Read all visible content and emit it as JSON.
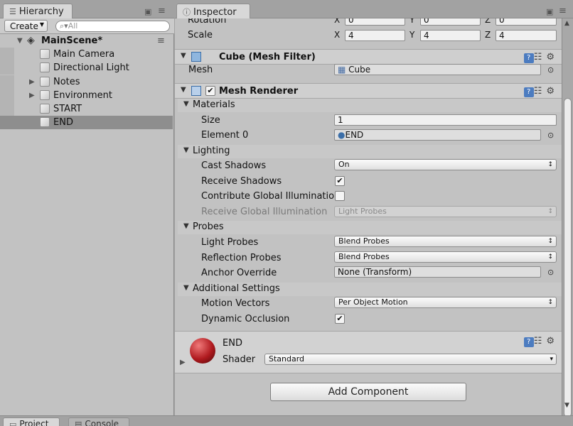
{
  "hierarchy": {
    "tab_label": "Hierarchy",
    "create_label": "Create",
    "search_placeholder": "All",
    "scene_name": "MainScene*",
    "items": [
      {
        "label": "Main Camera"
      },
      {
        "label": "Directional Light"
      },
      {
        "label": "Notes"
      },
      {
        "label": "Environment"
      },
      {
        "label": "START"
      },
      {
        "label": "END"
      }
    ]
  },
  "inspector": {
    "tab_label": "Inspector",
    "transform": {
      "rotation_label": "Rotation",
      "scale_label": "Scale",
      "rotation": {
        "x": "0",
        "y": "0",
        "z": "0"
      },
      "scale": {
        "x": "4",
        "y": "4",
        "z": "4"
      },
      "axis_x": "X",
      "axis_y": "Y",
      "axis_z": "Z"
    },
    "mesh_filter": {
      "title": "Cube (Mesh Filter)",
      "mesh_label": "Mesh",
      "mesh_value": "Cube"
    },
    "mesh_renderer": {
      "title": "Mesh Renderer",
      "enabled": true,
      "materials_label": "Materials",
      "size_label": "Size",
      "size_value": "1",
      "element0_label": "Element 0",
      "element0_value": "END",
      "lighting_label": "Lighting",
      "cast_shadows_label": "Cast Shadows",
      "cast_shadows_value": "On",
      "receive_shadows_label": "Receive Shadows",
      "receive_shadows": true,
      "contribute_gi_label": "Contribute Global Illumination",
      "contribute_gi": false,
      "receive_gi_label": "Receive Global Illumination",
      "receive_gi_value": "Light Probes",
      "probes_label": "Probes",
      "light_probes_label": "Light Probes",
      "light_probes_value": "Blend Probes",
      "reflection_probes_label": "Reflection Probes",
      "reflection_probes_value": "Blend Probes",
      "anchor_override_label": "Anchor Override",
      "anchor_override_value": "None (Transform)",
      "additional_label": "Additional Settings",
      "motion_vectors_label": "Motion Vectors",
      "motion_vectors_value": "Per Object Motion",
      "dynamic_occlusion_label": "Dynamic Occlusion",
      "dynamic_occlusion": true
    },
    "material": {
      "name": "END",
      "shader_label": "Shader",
      "shader_value": "Standard",
      "preview_color": "#b01a1f"
    },
    "add_component_label": "Add Component"
  },
  "bottom_tabs": [
    {
      "label": "Project"
    },
    {
      "label": "Console"
    }
  ],
  "icons": {
    "checkmark": "✔",
    "caret": "▾",
    "updown": "↕",
    "fold_open": "▼",
    "fold_closed": "▶",
    "lock": "🔒",
    "menu": "≡",
    "gear": "⚙",
    "sliders": "☷",
    "help": "?",
    "picker": "⊙"
  },
  "colors": {
    "selected_row": "#8e8e8e",
    "help_icon": "#4c7cc0"
  }
}
